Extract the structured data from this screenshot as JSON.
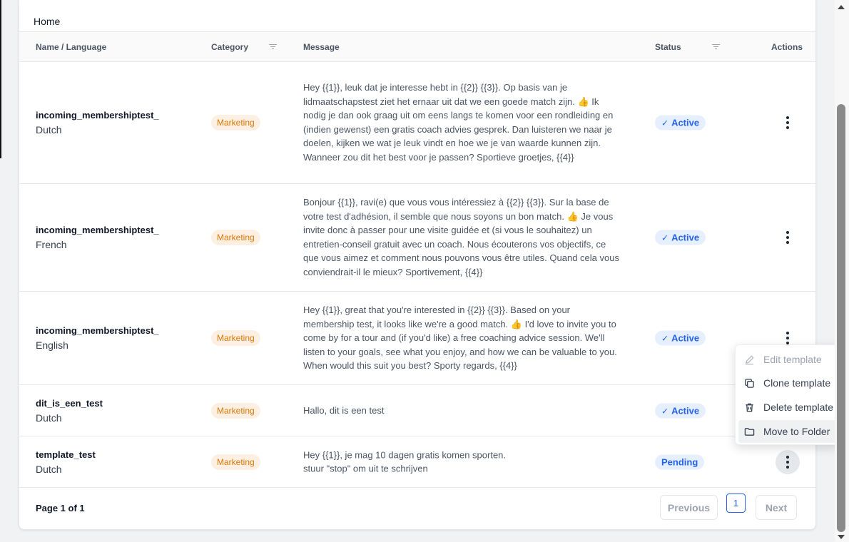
{
  "breadcrumb": "Home",
  "columns": {
    "name": "Name / Language",
    "category": "Category",
    "message": "Message",
    "status": "Status",
    "actions": "Actions"
  },
  "rows": [
    {
      "name": "incoming_membershiptest_",
      "language": "Dutch",
      "category": "Marketing",
      "message": "Hey {{1}}, leuk dat je interesse hebt in {{2}} {{3}}. Op basis van je lidmaatschapstest ziet het ernaar uit dat we een goede match zijn. 👍 Ik nodig je dan ook graag uit om eens langs te komen voor een rondleiding en (indien gewenst) een gratis coach advies gesprek. Dan luisteren we naar je doelen, kijken we wat je leuk vindt en hoe we je van waarde kunnen zijn. Wanneer zou dit het best voor je passen? Sportieve groetjes, {{4}}",
      "status": "Active"
    },
    {
      "name": "incoming_membershiptest_",
      "language": "French",
      "category": "Marketing",
      "message": "Bonjour {{1}}, ravi(e) que vous vous intéressiez à {{2}} {{3}}. Sur la base de votre test d'adhésion, il semble que nous soyons un bon match. 👍 Je vous invite donc à passer pour une visite guidée et (si vous le souhaitez) un entretien-conseil gratuit avec un coach. Nous écouterons vos objectifs, ce que vous aimez et comment nous pouvons vous être utiles. Quand cela vous conviendrait-il le mieux? Sportivement, {{4}}",
      "status": "Active"
    },
    {
      "name": "incoming_membershiptest_",
      "language": "English",
      "category": "Marketing",
      "message": "Hey {{1}}, great that you're interested in {{2}} {{3}}. Based on your membership test, it looks like we're a good match. 👍 I'd love to invite you to come by for a tour and (if you'd like) a free coaching advice session. We'll listen to your goals, see what you enjoy, and how we can be valuable to you. When would this suit you best? Sporty regards, {{4}}",
      "status": "Active"
    },
    {
      "name": "dit_is_een_test",
      "language": "Dutch",
      "category": "Marketing",
      "message": "Hallo, dit is een test",
      "status": "Active"
    },
    {
      "name": "template_test",
      "language": "Dutch",
      "category": "Marketing",
      "message": "Hey {{1}}, je mag 10 dagen gratis komen sporten.\nstuur \"stop\" om uit te schrijven",
      "status": "Pending"
    }
  ],
  "pagination": {
    "label": "Page 1 of 1",
    "previous": "Previous",
    "current": "1",
    "next": "Next"
  },
  "context_menu": {
    "edit": "Edit template",
    "clone": "Clone template",
    "delete": "Delete template",
    "move": "Move to Folder"
  },
  "colors": {
    "accent": "#2563eb",
    "marketing_tag_bg": "#fdf0e2",
    "marketing_tag_text": "#d97706",
    "status_bg": "#e6effd"
  },
  "icons": {
    "check": "check-icon",
    "filter": "filter-icon",
    "kebab": "more-vertical-icon",
    "edit": "pencil-icon",
    "clone": "copy-icon",
    "delete": "trash-icon",
    "move": "folder-icon"
  }
}
